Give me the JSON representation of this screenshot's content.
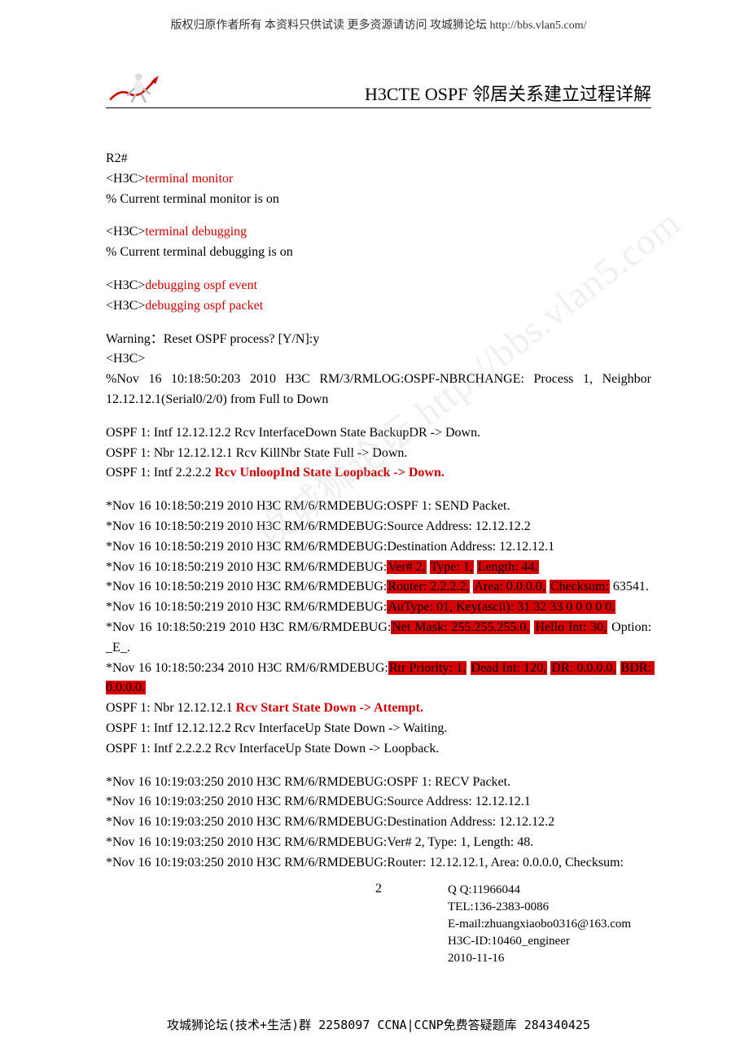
{
  "top_header": "版权归原作者所有 本资料只供试读 更多资源请访问 攻城狮论坛 http://bbs.vlan5.com/",
  "doc_title": "H3CTE OSPF 邻居关系建立过程详解",
  "watermark": "攻城狮论坛 http://bbs.vlan5.com",
  "c": {
    "l1": "R2#",
    "l2a": "<H3C>",
    "l2b": "terminal monitor",
    "l3": "% Current terminal monitor is on",
    "l4a": "<H3C>",
    "l4b": "terminal debugging",
    "l5": "% Current terminal debugging is on",
    "l6a": "<H3C>",
    "l6b": "debugging ospf event",
    "l7a": "<H3C>",
    "l7b": "debugging ospf packet",
    "l8": "Warning：Reset OSPF process? [Y/N]:y",
    "l9": "<H3C>",
    "l10": "%Nov 16 10:18:50:203 2010 H3C RM/3/RMLOG:OSPF-NBRCHANGE: Process 1, Neighbor 12.12.12.1(Serial0/2/0) from Full to Down",
    "l11": "OSPF 1: Intf 12.12.12.2 Rcv InterfaceDown State BackupDR -> Down.",
    "l12": "OSPF 1: Nbr 12.12.12.1 Rcv KillNbr State Full -> Down.",
    "l13a": "OSPF 1: Intf 2.2.2.2 ",
    "l13b": "Rcv UnloopInd State Loopback -> Down.",
    "l14": "*Nov 16 10:18:50:219 2010 H3C RM/6/RMDEBUG:OSPF 1: SEND Packet.",
    "l15": "*Nov 16 10:18:50:219 2010 H3C RM/6/RMDEBUG:Source Address: 12.12.12.2",
    "l16": "*Nov 16 10:18:50:219 2010 H3C RM/6/RMDEBUG:Destination Address: 12.12.12.1",
    "l17a": "*Nov 16 10:18:50:219 2010 H3C RM/6/RMDEBUG:",
    "l17b": "Ver# 2,",
    "l17c": " ",
    "l17d": "Type: 1,",
    "l17e": " ",
    "l17f": "Length: 44.",
    "l18a": "*Nov 16 10:18:50:219 2010 H3C RM/6/RMDEBUG:",
    "l18b": "Router: 2.2.2.2,",
    "l18c": " ",
    "l18d": "Area: 0.0.0.0,",
    "l18e": " ",
    "l18f": "Checksum:",
    "l18g": " 63541.",
    "l19a": "*Nov 16 10:18:50:219 2010 H3C RM/6/RMDEBUG:",
    "l19b": "AuType: 01, Key(ascii): 31 32 33 0 0 0 0 0.",
    "l20a": "*Nov 16 10:18:50:219 2010 H3C RM/6/RMDEBUG:",
    "l20b": "Net Mask: 255.255.255.0,",
    "l20c": " ",
    "l20d": "Hello Int: 30,",
    "l20e": " Option: _E_.",
    "l21a": "*Nov 16 10:18:50:234 2010 H3C RM/6/RMDEBUG:",
    "l21b": "Rtr Priority: 1,",
    "l21c": " ",
    "l21d": "Dead Int: 120,",
    "l21e": " ",
    "l21f": "DR: 0.0.0.0,",
    "l21g": " ",
    "l21h": "BDR: 0.0.0.0.",
    "l22a": "OSPF 1: Nbr 12.12.12.1 ",
    "l22b": "Rcv Start State Down -> Attempt.",
    "l23": "OSPF 1: Intf 12.12.12.2 Rcv InterfaceUp State Down -> Waiting.",
    "l24": "OSPF 1: Intf 2.2.2.2 Rcv InterfaceUp State Down -> Loopback.",
    "l25": "*Nov 16 10:19:03:250 2010 H3C RM/6/RMDEBUG:OSPF 1: RECV Packet.",
    "l26": "*Nov 16 10:19:03:250 2010 H3C RM/6/RMDEBUG:Source Address: 12.12.12.1",
    "l27": "*Nov 16 10:19:03:250 2010 H3C RM/6/RMDEBUG:Destination Address: 12.12.12.2",
    "l28": "*Nov 16 10:19:03:250 2010 H3C RM/6/RMDEBUG:Ver# 2, Type: 1, Length: 48.",
    "l29": "*Nov 16 10:19:03:250 2010 H3C RM/6/RMDEBUG:Router: 12.12.12.1, Area: 0.0.0.0, Checksum:"
  },
  "page_num": "2",
  "footer": {
    "qq": "Q Q:11966044",
    "tel": "TEL:136-2383-0086",
    "email": "E-mail:zhuangxiaobo0316@163.com",
    "h3cid": "H3C-ID:10460_engineer",
    "date": "2010-11-16"
  },
  "bottom_footer": "攻城狮论坛(技术+生活)群 2258097 CCNA|CCNP免费答疑题库 284340425"
}
